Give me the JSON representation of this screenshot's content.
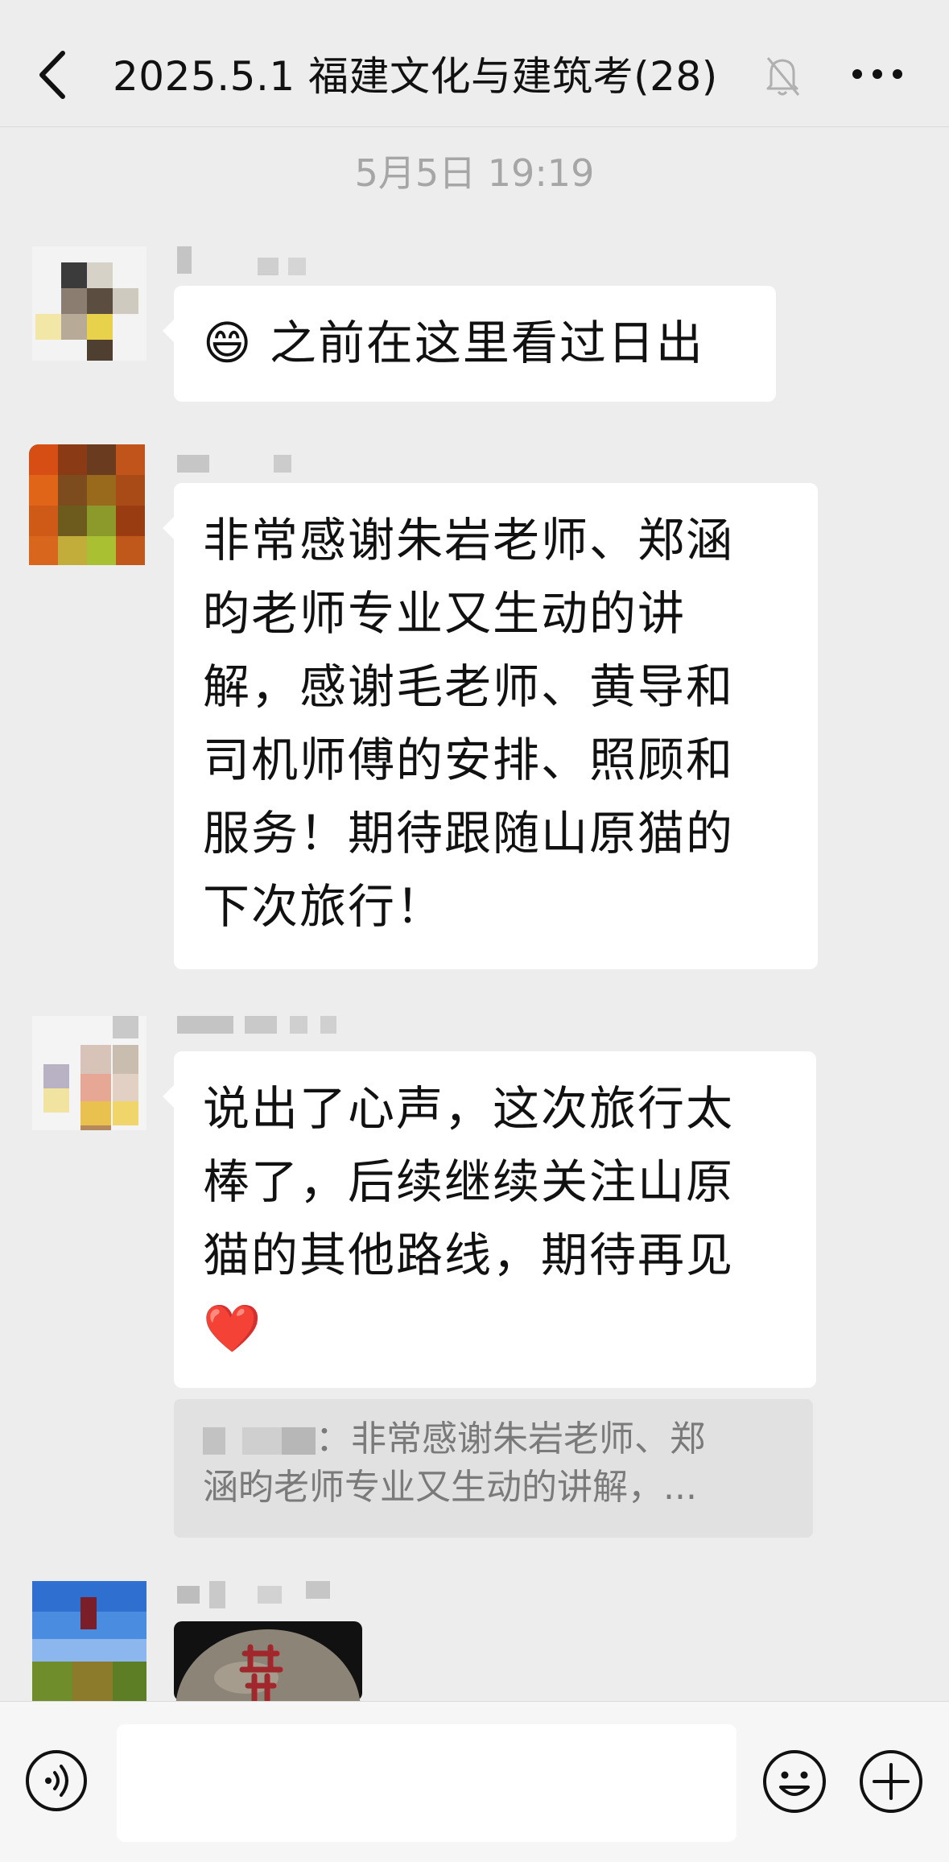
{
  "header": {
    "title_main": "2025.5.1 福建文化与建筑考",
    "title_count": "(28)"
  },
  "timestamp": "5月5日 19:19",
  "messages": [
    {
      "lines": [
        "之前在这里看过日出"
      ],
      "emoji": "😄"
    },
    {
      "lines": [
        "非常感谢朱岩老师、郑涵",
        "昀老师专业又生动的讲",
        "解，感谢毛老师、黄导和",
        "司机师傅的安排、照顾和",
        "服务！期待跟随山原猫的",
        "下次旅行！"
      ]
    },
    {
      "lines": [
        "说出了心声，这次旅行太",
        "棒了，后续继续关注山原",
        "猫的其他路线，期待再见"
      ],
      "emoji": "❤️",
      "quote": {
        "line1": "：非常感谢朱岩老师、郑",
        "line2": "涵昀老师专业又生动的讲解，..."
      }
    }
  ],
  "input": {
    "placeholder": ""
  }
}
